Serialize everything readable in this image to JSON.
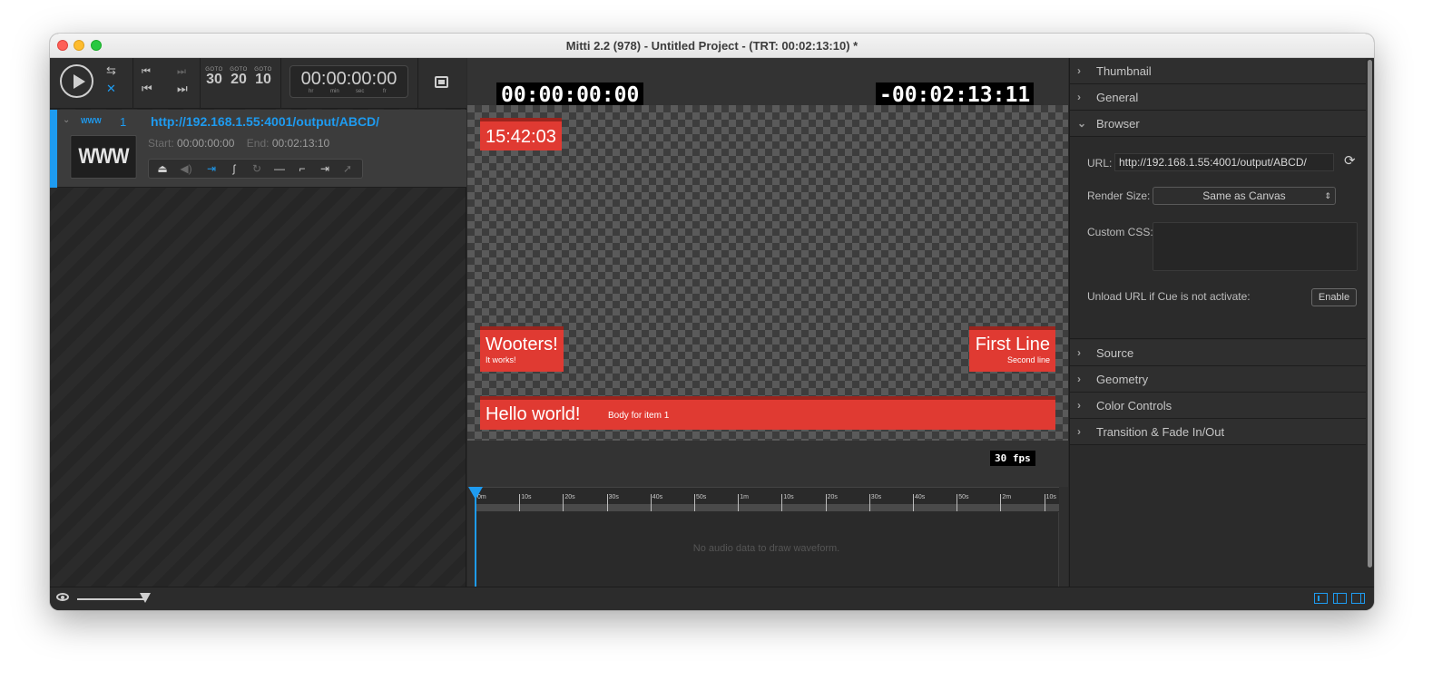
{
  "window": {
    "title": "Mitti 2.2 (978) - Untitled Project - (TRT: 00:02:13:10) *"
  },
  "toolbar": {
    "goto": [
      {
        "label": "GOTO",
        "value": "30"
      },
      {
        "label": "GOTO",
        "value": "20"
      },
      {
        "label": "GOTO",
        "value": "10"
      }
    ],
    "timecode": "00:00:00:00",
    "timecode_units": [
      "hr",
      "min",
      "sec",
      "fr"
    ]
  },
  "cue": {
    "type_badge": "WWW",
    "number": "1",
    "url": "http://192.168.1.55:4001/output/ABCD/",
    "thumbnail_text": "WWW",
    "start_label": "Start:",
    "start_value": "00:00:00:00",
    "end_label": "End:",
    "end_value": "00:02:13:10"
  },
  "preview": {
    "elapsed": "00:00:00:00",
    "remaining": "-00:02:13:11",
    "clock": "15:42:03",
    "lower_third_left": {
      "title": "Wooters!",
      "subtitle": "It works!"
    },
    "lower_third_right": {
      "title": "First Line",
      "subtitle": "Second line"
    },
    "banner": {
      "title": "Hello world!",
      "body": "Body for item 1"
    },
    "fps": "30 fps"
  },
  "timeline": {
    "ruler_labels": [
      "0m",
      "10s",
      "20s",
      "30s",
      "40s",
      "50s",
      "1m",
      "10s",
      "20s",
      "30s",
      "40s",
      "50s",
      "2m",
      "10s"
    ],
    "empty_text": "No audio data to draw waveform."
  },
  "inspector": {
    "sections": [
      "Thumbnail",
      "General",
      "Browser",
      "Source",
      "Geometry",
      "Color Controls",
      "Transition & Fade In/Out"
    ],
    "browser": {
      "url_label": "URL:",
      "url_value": "http://192.168.1.55:4001/output/ABCD/",
      "render_size_label": "Render Size:",
      "render_size_value": "Same as Canvas",
      "custom_css_label": "Custom CSS:",
      "unload_label": "Unload URL if Cue is not activate:",
      "enable_button": "Enable"
    }
  },
  "colors": {
    "accent": "#1e9bf0",
    "graphics_red": "#e03a32"
  }
}
